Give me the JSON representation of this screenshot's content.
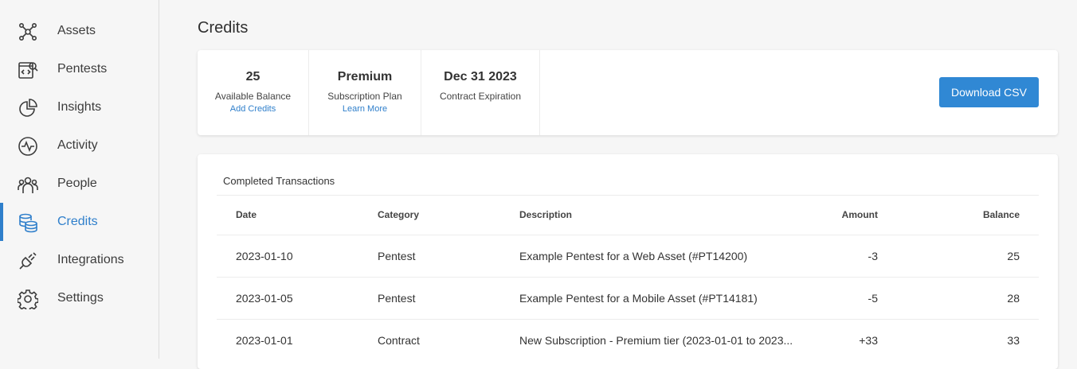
{
  "sidebar": {
    "items": [
      {
        "label": "Assets",
        "icon": "network-nodes-icon"
      },
      {
        "label": "Pentests",
        "icon": "pentest-code-icon"
      },
      {
        "label": "Insights",
        "icon": "pie-chart-icon"
      },
      {
        "label": "Activity",
        "icon": "pulse-icon"
      },
      {
        "label": "People",
        "icon": "people-icon"
      },
      {
        "label": "Credits",
        "icon": "coins-stack-icon",
        "active": true
      },
      {
        "label": "Integrations",
        "icon": "plug-icon"
      },
      {
        "label": "Settings",
        "icon": "gear-icon"
      }
    ]
  },
  "page": {
    "title": "Credits"
  },
  "summary": {
    "balance": {
      "value": "25",
      "label": "Available Balance",
      "link": "Add Credits"
    },
    "plan": {
      "value": "Premium",
      "label": "Subscription Plan",
      "link": "Learn More"
    },
    "expiration": {
      "value": "Dec 31 2023",
      "label": "Contract Expiration"
    },
    "download_label": "Download CSV"
  },
  "transactions": {
    "title": "Completed Transactions",
    "columns": {
      "date": "Date",
      "category": "Category",
      "description": "Description",
      "amount": "Amount",
      "balance": "Balance"
    },
    "rows": [
      {
        "date": "2023-01-10",
        "category": "Pentest",
        "description": "Example Pentest for a Web Asset (#PT14200)",
        "amount": "-3",
        "balance": "25"
      },
      {
        "date": "2023-01-05",
        "category": "Pentest",
        "description": "Example Pentest for a Mobile Asset (#PT14181)",
        "amount": "-5",
        "balance": "28"
      },
      {
        "date": "2023-01-01",
        "category": "Contract",
        "description": "New Subscription - Premium tier (2023-01-01 to 2023...",
        "amount": "+33",
        "balance": "33"
      }
    ]
  },
  "colors": {
    "accent": "#2f7fcb",
    "button": "#3088d4",
    "icon": "#3c3c3c"
  }
}
